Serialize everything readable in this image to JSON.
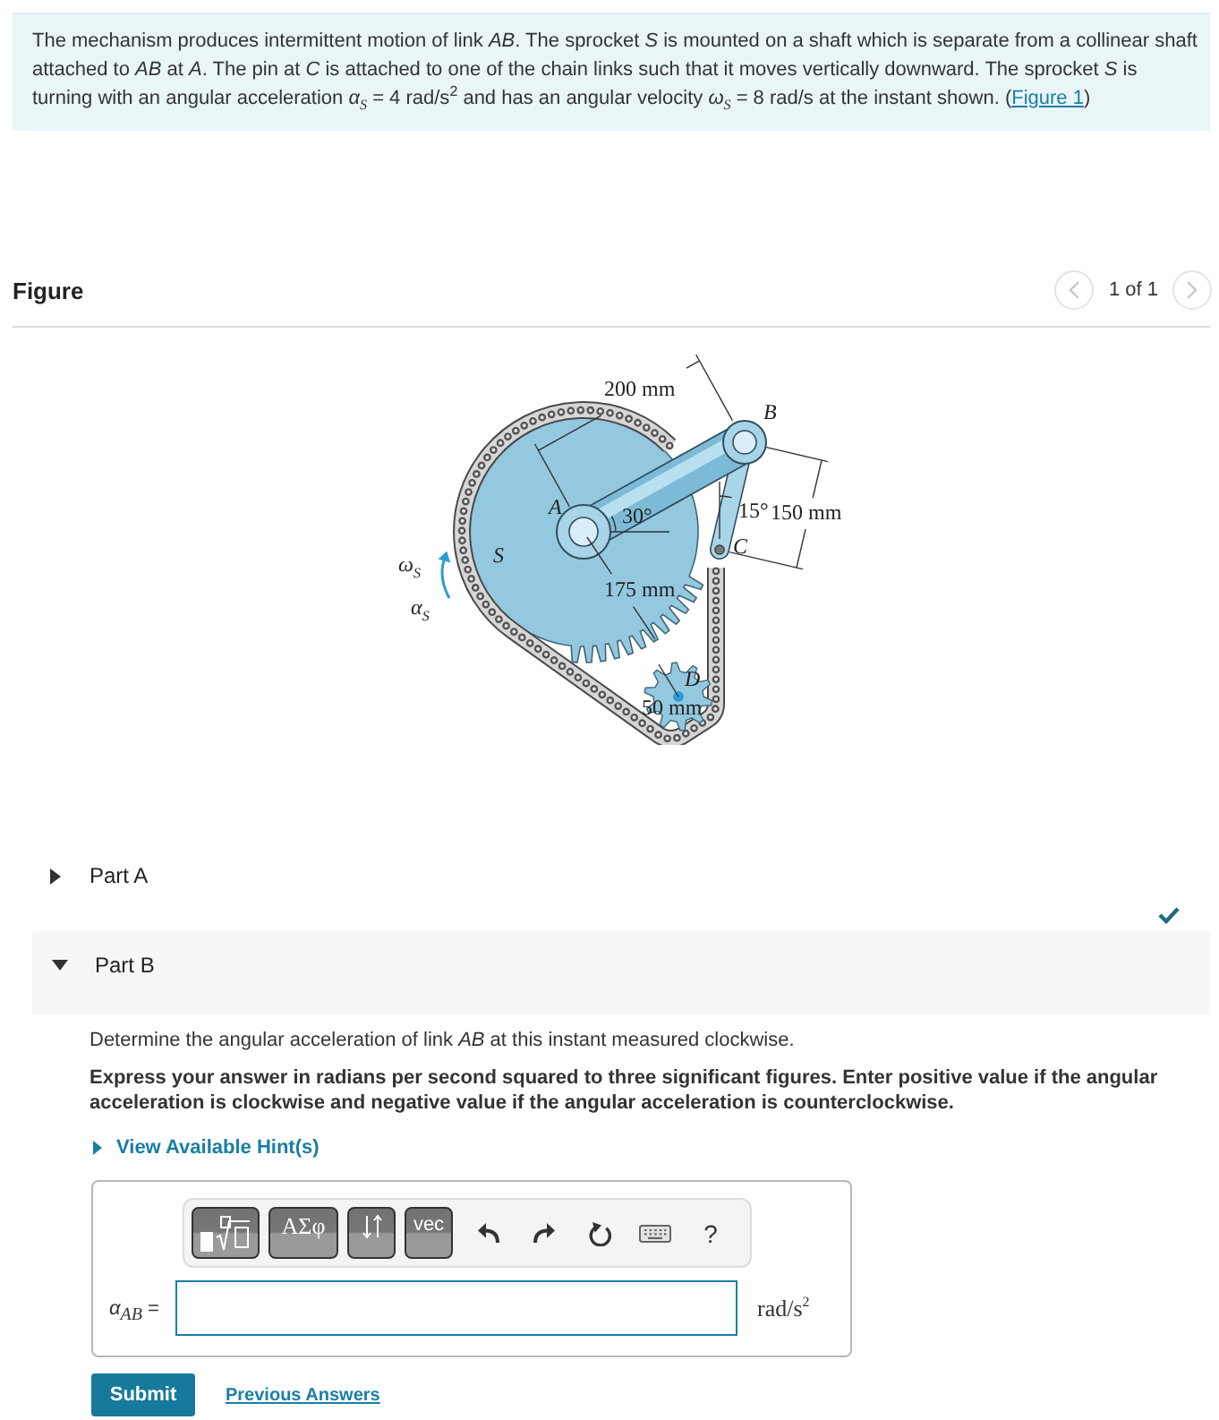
{
  "problem": {
    "text": "The mechanism produces intermittent motion of link *AB*. The sprocket *S* is mounted on a shaft which is separate from a collinear shaft attached to *AB* at *A*. The pin at *C* is attached to one of the chain links such that it moves vertically downward. The sprocket *S* is turning with an angular acceleration *α*$_{S}$ = 4 rad/s$^{2}$ and has an angular velocity *ω*$_{S}$ = 8 rad/s at the instant shown. (",
    "link": "Figure 1",
    "text_end": ")"
  },
  "figure": {
    "title": "Figure",
    "pager": {
      "text": "1 of 1",
      "prev_disabled": true,
      "next_disabled": true
    },
    "labels": [
      {
        "kind": "dimension",
        "text": "200 mm"
      },
      {
        "kind": "point",
        "text": "B"
      },
      {
        "kind": "point",
        "text": "A"
      },
      {
        "kind": "angle",
        "text": "30°"
      },
      {
        "kind": "angle",
        "text": "15°"
      },
      {
        "kind": "dimension",
        "text": "150 mm"
      },
      {
        "kind": "point",
        "text": "C"
      },
      {
        "kind": "point",
        "text": "S"
      },
      {
        "kind": "symbol",
        "text": "ω$_{S}$"
      },
      {
        "kind": "symbol",
        "text": "α$_{S}$"
      },
      {
        "kind": "dimension",
        "text": "175 mm"
      },
      {
        "kind": "point",
        "text": "D"
      },
      {
        "kind": "dimension",
        "text": "50 mm"
      }
    ]
  },
  "parts": [
    {
      "label": "Part A",
      "expanded": false,
      "completed": true
    },
    {
      "label": "Part B",
      "expanded": true,
      "completed": false,
      "body": {
        "question": "Determine the angular acceleration of link *AB* at this instant measured clockwise.",
        "instructions": "Express your answer in radians per second squared to three significant figures. Enter positive value if the angular acceleration is clockwise and negative value if the angular acceleration is counterclockwise.",
        "hint_link": "View Available Hint(s)",
        "toolbar": [
          {
            "kind": "template"
          },
          {
            "kind": "symbols",
            "label": "ΑΣφ"
          },
          {
            "kind": "arrows"
          },
          {
            "kind": "vector",
            "label": "vec"
          },
          {
            "kind": "undo"
          },
          {
            "kind": "redo"
          },
          {
            "kind": "reset"
          },
          {
            "kind": "keyboard"
          },
          {
            "kind": "help",
            "label": "?"
          }
        ],
        "answer": {
          "label": "*α*$_{AB}$ =",
          "unit": "rad/s$^{2}$"
        },
        "submit": "Submit",
        "previous_answers": "Previous Answers"
      }
    }
  ]
}
